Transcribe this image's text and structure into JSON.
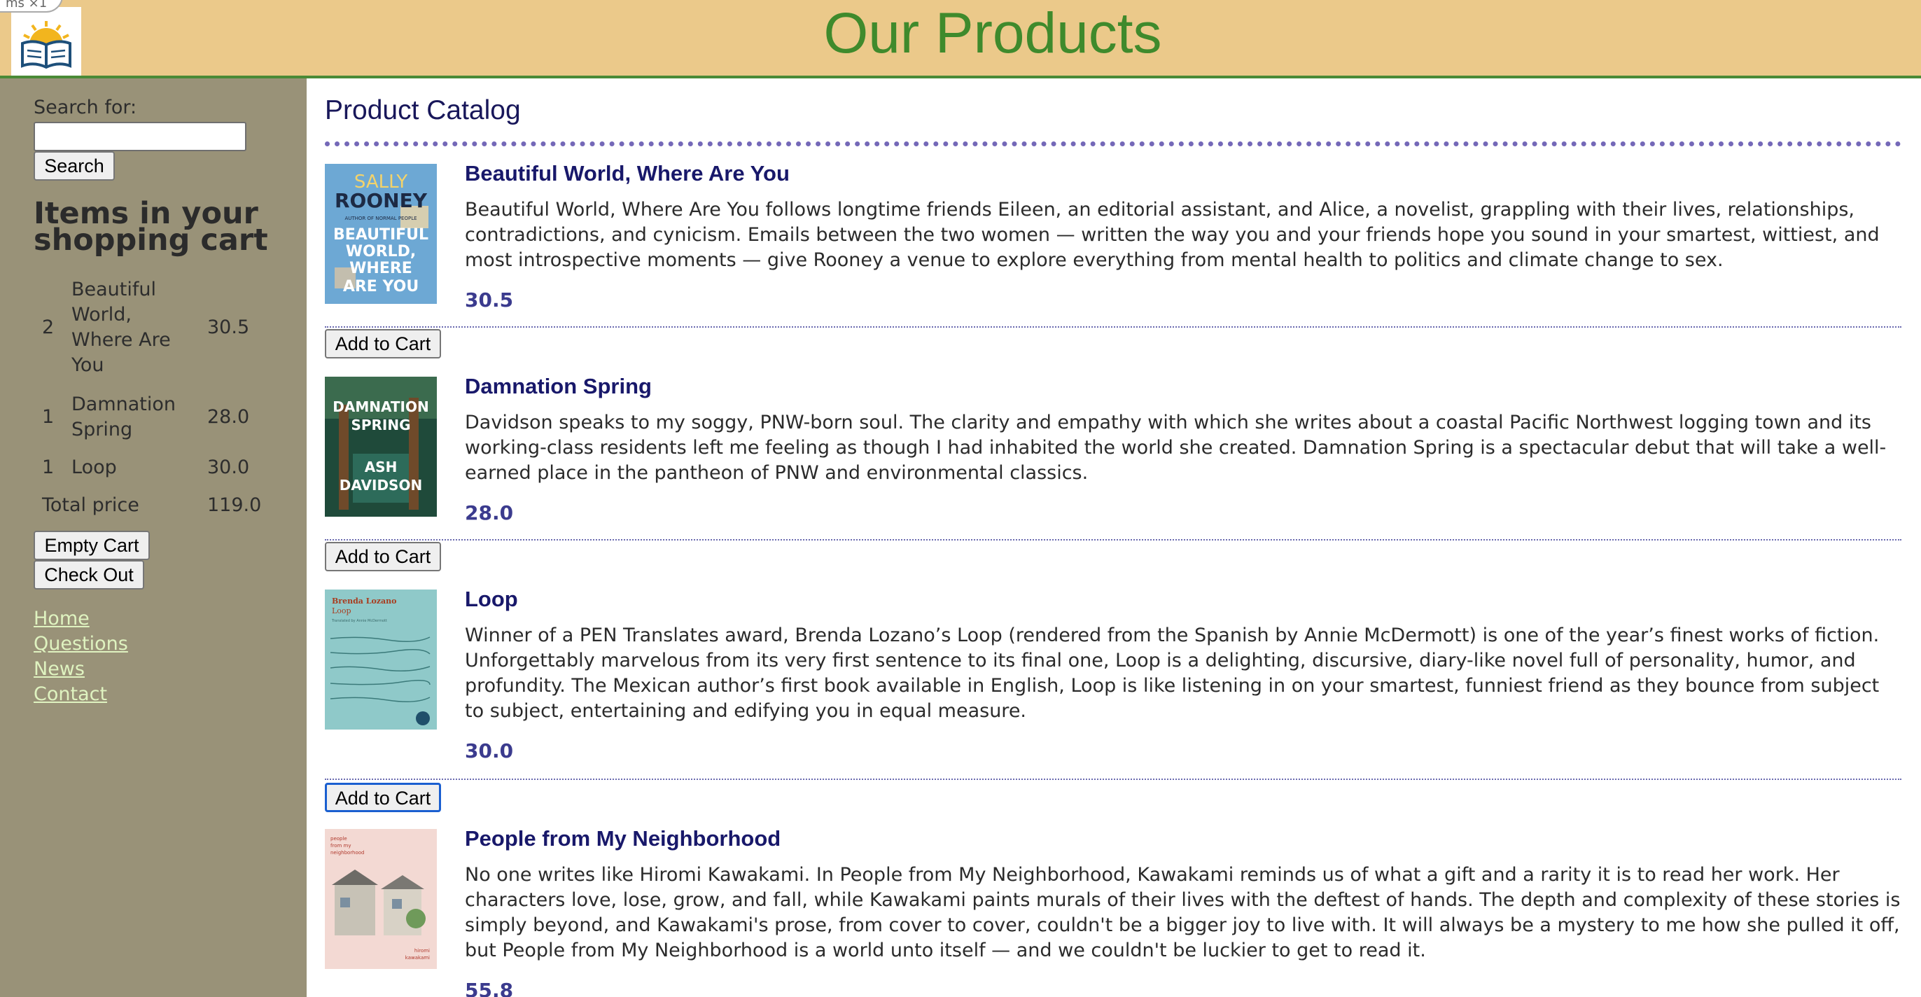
{
  "header": {
    "title": "Our Products",
    "corner_tab": "ms ×1"
  },
  "sidebar": {
    "search_label": "Search for:",
    "search_value": "",
    "search_button": "Search",
    "cart_title": "Items in your shopping cart",
    "cart_items": [
      {
        "qty": "2",
        "title": "Beautiful World, Where Are You",
        "price": "30.5"
      },
      {
        "qty": "1",
        "title": "Damnation Spring",
        "price": "28.0"
      },
      {
        "qty": "1",
        "title": "Loop",
        "price": "30.0"
      }
    ],
    "total_label": "Total price",
    "total_value": "119.0",
    "empty_button": "Empty Cart",
    "checkout_button": "Check Out",
    "links": [
      "Home",
      "Questions",
      "News",
      "Contact"
    ]
  },
  "main": {
    "catalog_title": "Product Catalog",
    "add_to_cart_label": "Add to Cart",
    "products": [
      {
        "title": "Beautiful World, Where Are You",
        "description": "Beautiful World, Where Are You follows longtime friends Eileen, an editorial assistant, and Alice, a novelist, grappling with their lives, relationships, contradictions, and cynicism. Emails between the two women — written the way you and your friends hope you sound in your smartest, wittiest, and most introspective moments — give Rooney a venue to explore everything from mental health to politics and climate change to sex.",
        "price": "30.5",
        "cover_text": [
          "SALLY",
          "ROONEY",
          "AUTHOR OF NORMAL PEOPLE",
          "BEAUTIFUL",
          "WORLD,",
          "WHERE",
          "ARE YOU"
        ]
      },
      {
        "title": "Damnation Spring",
        "description": "Davidson speaks to my soggy, PNW-born soul. The clarity and empathy with which she writes about a coastal Pacific Northwest logging town and its working-class residents left me feeling as though I had inhabited the world she created. Damnation Spring is a spectacular debut that will take a well-earned place in the pantheon of PNW and environmental classics.",
        "price": "28.0",
        "cover_text": [
          "DAMNATION",
          "SPRING",
          "ASH",
          "DAVIDSON"
        ]
      },
      {
        "title": "Loop",
        "description": "Winner of a PEN Translates award, Brenda Lozano’s Loop (rendered from the Spanish by Annie McDermott) is one of the year’s finest works of fiction. Unforgettably marvelous from its very first sentence to its final one, Loop is a delighting, discursive, diary-like novel full of personality, humor, and profundity. The Mexican author’s first book available in English, Loop is like listening in on your smartest, funniest friend as they bounce from subject to subject, entertaining and edifying you in equal measure.",
        "price": "30.0",
        "cover_text": [
          "Brenda Lozano",
          "Loop",
          "Translated by Annie McDermott"
        ]
      },
      {
        "title": "People from My Neighborhood",
        "description": "No one writes like Hiromi Kawakami. In People from My Neighborhood, Kawakami reminds us of what a gift and a rarity it is to read her work. Her characters love, lose, grow, and fall, while Kawakami paints murals of their lives with the deftest of hands. The depth and complexity of these stories is simply beyond, and Kawakami's prose, from cover to cover, couldn't be a bigger joy to live with. It will always be a mystery to me how she pulled it off, but People from My Neighborhood is a world unto itself — and we couldn't be luckier to get to read it.",
        "price": "55.8",
        "cover_text": [
          "people",
          "from my",
          "neighborhood",
          "hiromi",
          "kawakami"
        ]
      }
    ]
  },
  "colors": {
    "header_bg": "#ebc98a",
    "title_green": "#3f8a2c",
    "sidebar_bg": "#999278",
    "link": "#dff3c0",
    "product_title": "#18186a",
    "price": "#3b3b8e"
  }
}
